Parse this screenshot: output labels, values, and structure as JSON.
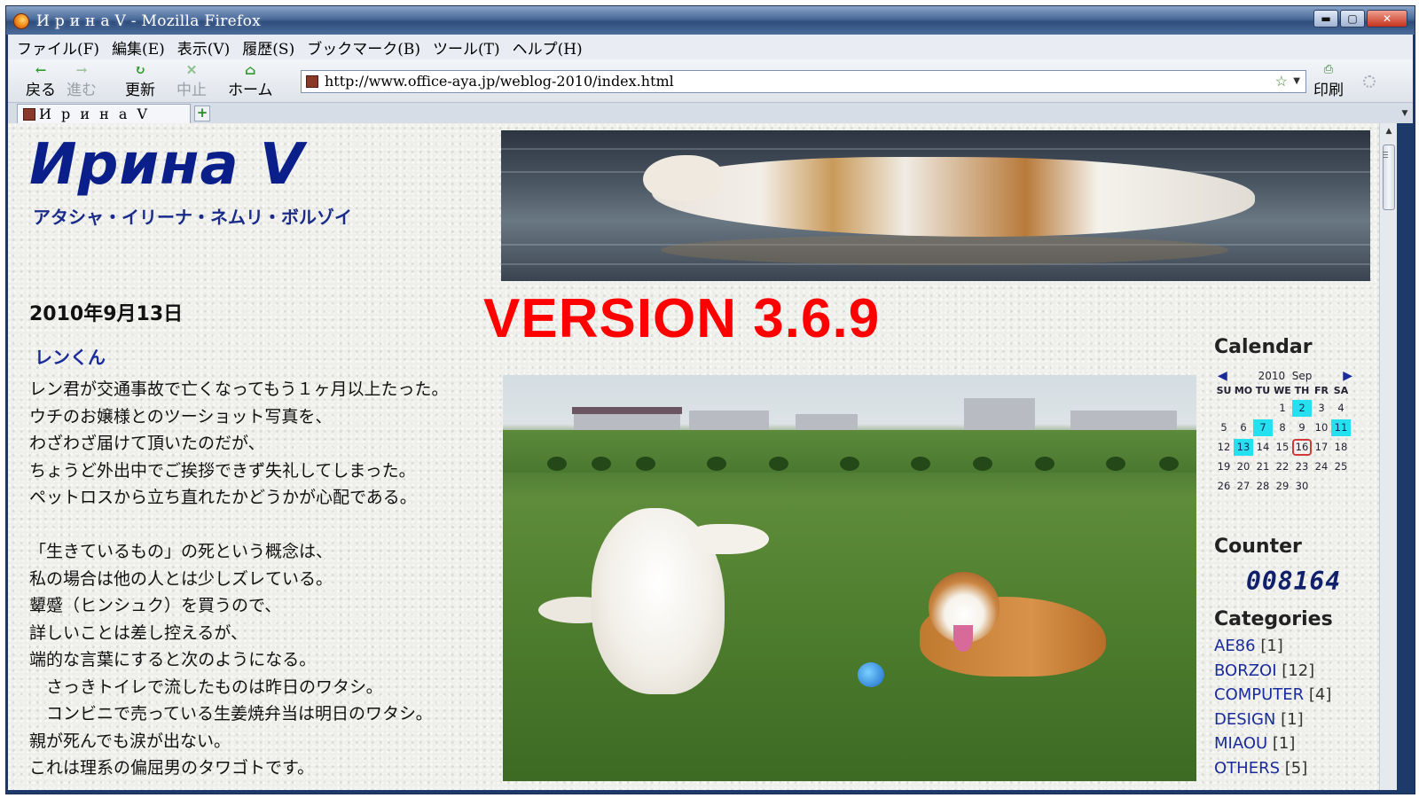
{
  "window": {
    "title": "И р и н а  V - Mozilla Firefox",
    "minimize_label": "▬",
    "maximize_label": "▢",
    "close_label": "✕"
  },
  "menubar": {
    "items": [
      "ファイル(F)",
      "編集(E)",
      "表示(V)",
      "履歴(S)",
      "ブックマーク(B)",
      "ツール(T)",
      "ヘルプ(H)"
    ]
  },
  "toolbar": {
    "back": "戻る",
    "forward": "進む",
    "reload": "更新",
    "stop": "中止",
    "home": "ホーム",
    "print": "印刷"
  },
  "urlbar": {
    "url": "http://www.office-aya.jp/weblog-2010/index.html"
  },
  "tabs": [
    {
      "label": "И р и н а  V"
    }
  ],
  "page": {
    "site_title": "Ирина V",
    "site_subtitle": "アタシャ・イリーナ・ネムリ・ボルゾイ",
    "version_overlay": "VERSION 3.6.9",
    "post": {
      "date": "2010年9月13日",
      "title": "レンくん",
      "lines": [
        "レン君が交通事故で亡くなってもう１ヶ月以上たった。",
        "ウチのお嬢様とのツーショット写真を、",
        "わざわざ届けて頂いたのだが、",
        "ちょうど外出中でご挨拶できず失礼してしまった。",
        "ペットロスから立ち直れたかどうかが心配である。",
        "",
        "「生きているもの」の死という概念は、",
        "私の場合は他の人とは少しズレている。",
        "顰蹙（ヒンシュク）を買うので、",
        "詳しいことは差し控えるが、",
        "端的な言葉にすると次のようになる。",
        "　さっきトイレで流したものは昨日のワタシ。",
        "　コンビニで売っている生姜焼弁当は明日のワタシ。",
        "親が死んでも涙が出ない。",
        "これは理系の偏屈男のタワゴトです。"
      ]
    },
    "sidebar": {
      "calendar": {
        "heading": "Calendar",
        "year": "2010",
        "month": "Sep",
        "prev": "◀",
        "next": "▶",
        "dow": [
          "SU",
          "MO",
          "TU",
          "WE",
          "TH",
          "FR",
          "SA"
        ],
        "first_weekday": 3,
        "days_in_month": 30,
        "post_days": [
          2,
          7,
          11,
          13
        ],
        "today": 16
      },
      "counter": {
        "heading": "Counter",
        "value": "008164"
      },
      "categories": {
        "heading": "Categories",
        "items": [
          {
            "name": "AE86",
            "count": "[1]"
          },
          {
            "name": "BORZOI",
            "count": "[12]"
          },
          {
            "name": "COMPUTER",
            "count": "[4]"
          },
          {
            "name": "DESIGN",
            "count": "[1]"
          },
          {
            "name": "MIAOU",
            "count": "[1]"
          },
          {
            "name": "OTHERS",
            "count": "[5]"
          }
        ]
      }
    }
  }
}
